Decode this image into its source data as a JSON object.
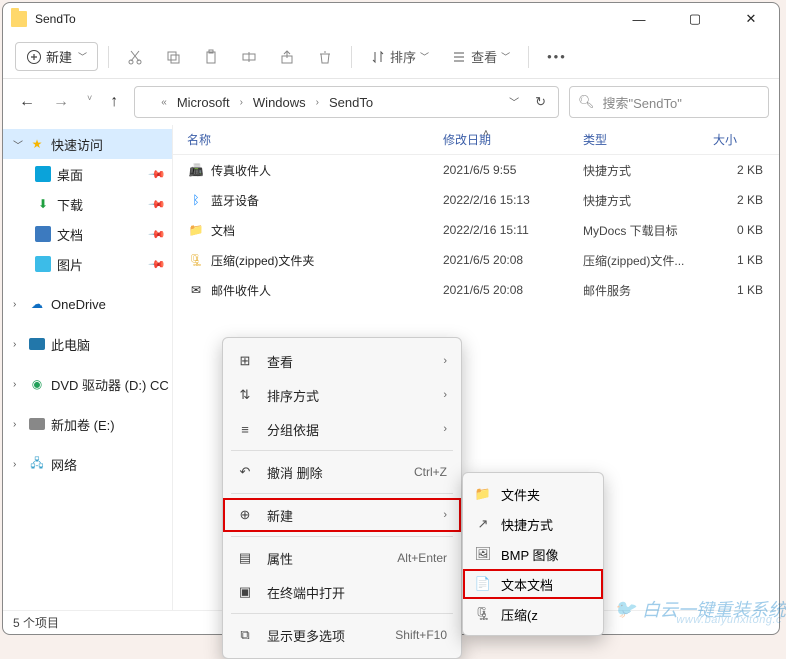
{
  "window": {
    "title": "SendTo"
  },
  "toolbar": {
    "new_label": "新建",
    "sort_label": "排序",
    "view_label": "查看"
  },
  "address": {
    "chevrons": "«",
    "segments": [
      "Microsoft",
      "Windows",
      "SendTo"
    ]
  },
  "search": {
    "placeholder": "搜索\"SendTo\""
  },
  "sidebar": {
    "quick_access": "快速访问",
    "desktop": "桌面",
    "downloads": "下载",
    "documents": "文档",
    "pictures": "图片",
    "onedrive": "OneDrive",
    "this_pc": "此电脑",
    "dvd": "DVD 驱动器 (D:) CC",
    "volume": "新加卷 (E:)",
    "network": "网络"
  },
  "columns": {
    "name": "名称",
    "date": "修改日期",
    "type": "类型",
    "size": "大小"
  },
  "files": [
    {
      "name": "传真收件人",
      "date": "2021/6/5 9:55",
      "type": "快捷方式",
      "size": "2 KB"
    },
    {
      "name": "蓝牙设备",
      "date": "2022/2/16 15:13",
      "type": "快捷方式",
      "size": "2 KB"
    },
    {
      "name": "文档",
      "date": "2022/2/16 15:11",
      "type": "MyDocs 下载目标",
      "size": "0 KB"
    },
    {
      "name": "压缩(zipped)文件夹",
      "date": "2021/6/5 20:08",
      "type": "压缩(zipped)文件...",
      "size": "1 KB"
    },
    {
      "name": "邮件收件人",
      "date": "2021/6/5 20:08",
      "type": "邮件服务",
      "size": "1 KB"
    }
  ],
  "status": {
    "count_label": "5 个项目"
  },
  "context_menu": {
    "view": "查看",
    "sort": "排序方式",
    "group": "分组依据",
    "undo": "撤消 删除",
    "undo_sc": "Ctrl+Z",
    "new": "新建",
    "props": "属性",
    "props_sc": "Alt+Enter",
    "terminal": "在终端中打开",
    "more": "显示更多选项",
    "more_sc": "Shift+F10"
  },
  "submenu": {
    "folder": "文件夹",
    "shortcut": "快捷方式",
    "bmp": "BMP 图像",
    "txt": "文本文档",
    "zip": "压缩(z"
  },
  "watermark": {
    "text": "白云一键重装系统",
    "url": "www.baiyunxitong.c"
  }
}
